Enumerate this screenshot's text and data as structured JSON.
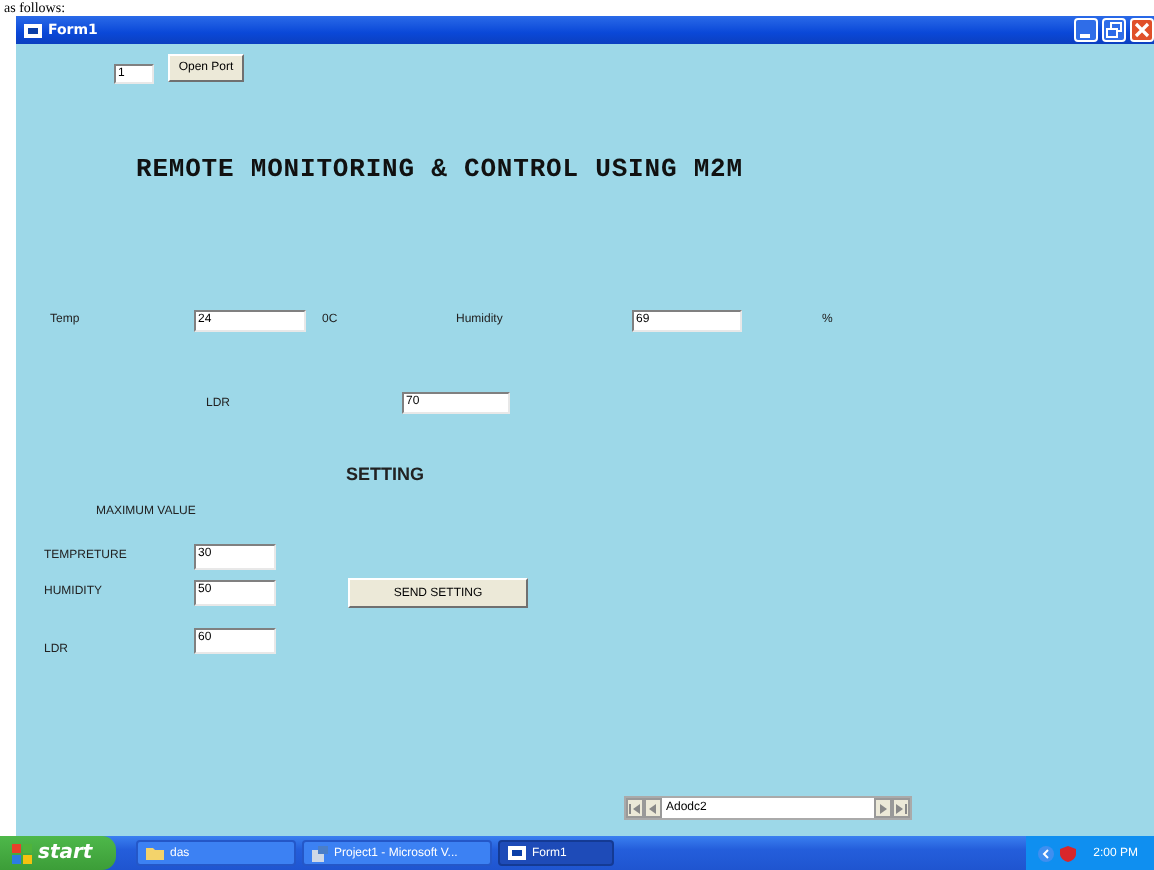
{
  "document_text": "as follows:",
  "window": {
    "title": "Form1"
  },
  "controls": [
    {
      "kind": "textbox",
      "value": "1"
    },
    {
      "kind": "button",
      "text": "Open Port"
    },
    {
      "kind": "heading",
      "text": "REMOTE MONITORING & CONTROL USING M2M"
    },
    {
      "kind": "label",
      "text": "Temp"
    },
    {
      "kind": "textbox",
      "value": "24"
    },
    {
      "kind": "label",
      "text": "0C"
    },
    {
      "kind": "label",
      "text": "Humidity"
    },
    {
      "kind": "textbox",
      "value": "69"
    },
    {
      "kind": "label",
      "text": "%"
    },
    {
      "kind": "label",
      "text": "LDR"
    },
    {
      "kind": "textbox",
      "value": "70"
    },
    {
      "kind": "subheading",
      "text": "SETTING"
    },
    {
      "kind": "label",
      "text": "MAXIMUM VALUE"
    },
    {
      "kind": "label",
      "text": "TEMPRETURE"
    },
    {
      "kind": "textbox",
      "value": "30"
    },
    {
      "kind": "label",
      "text": "HUMIDITY"
    },
    {
      "kind": "textbox",
      "value": "50"
    },
    {
      "kind": "button",
      "text": "SEND SETTING"
    },
    {
      "kind": "label",
      "text": "LDR"
    },
    {
      "kind": "textbox",
      "value": "60"
    },
    {
      "kind": "datacontrol",
      "text": "Adodc2"
    }
  ],
  "taskbar": {
    "start": "start",
    "tasks": [
      {
        "label": "das",
        "selected": false
      },
      {
        "label": "Project1 - Microsoft V...",
        "selected": false
      },
      {
        "label": "Form1",
        "selected": true
      }
    ],
    "clock": "2:00 PM"
  }
}
